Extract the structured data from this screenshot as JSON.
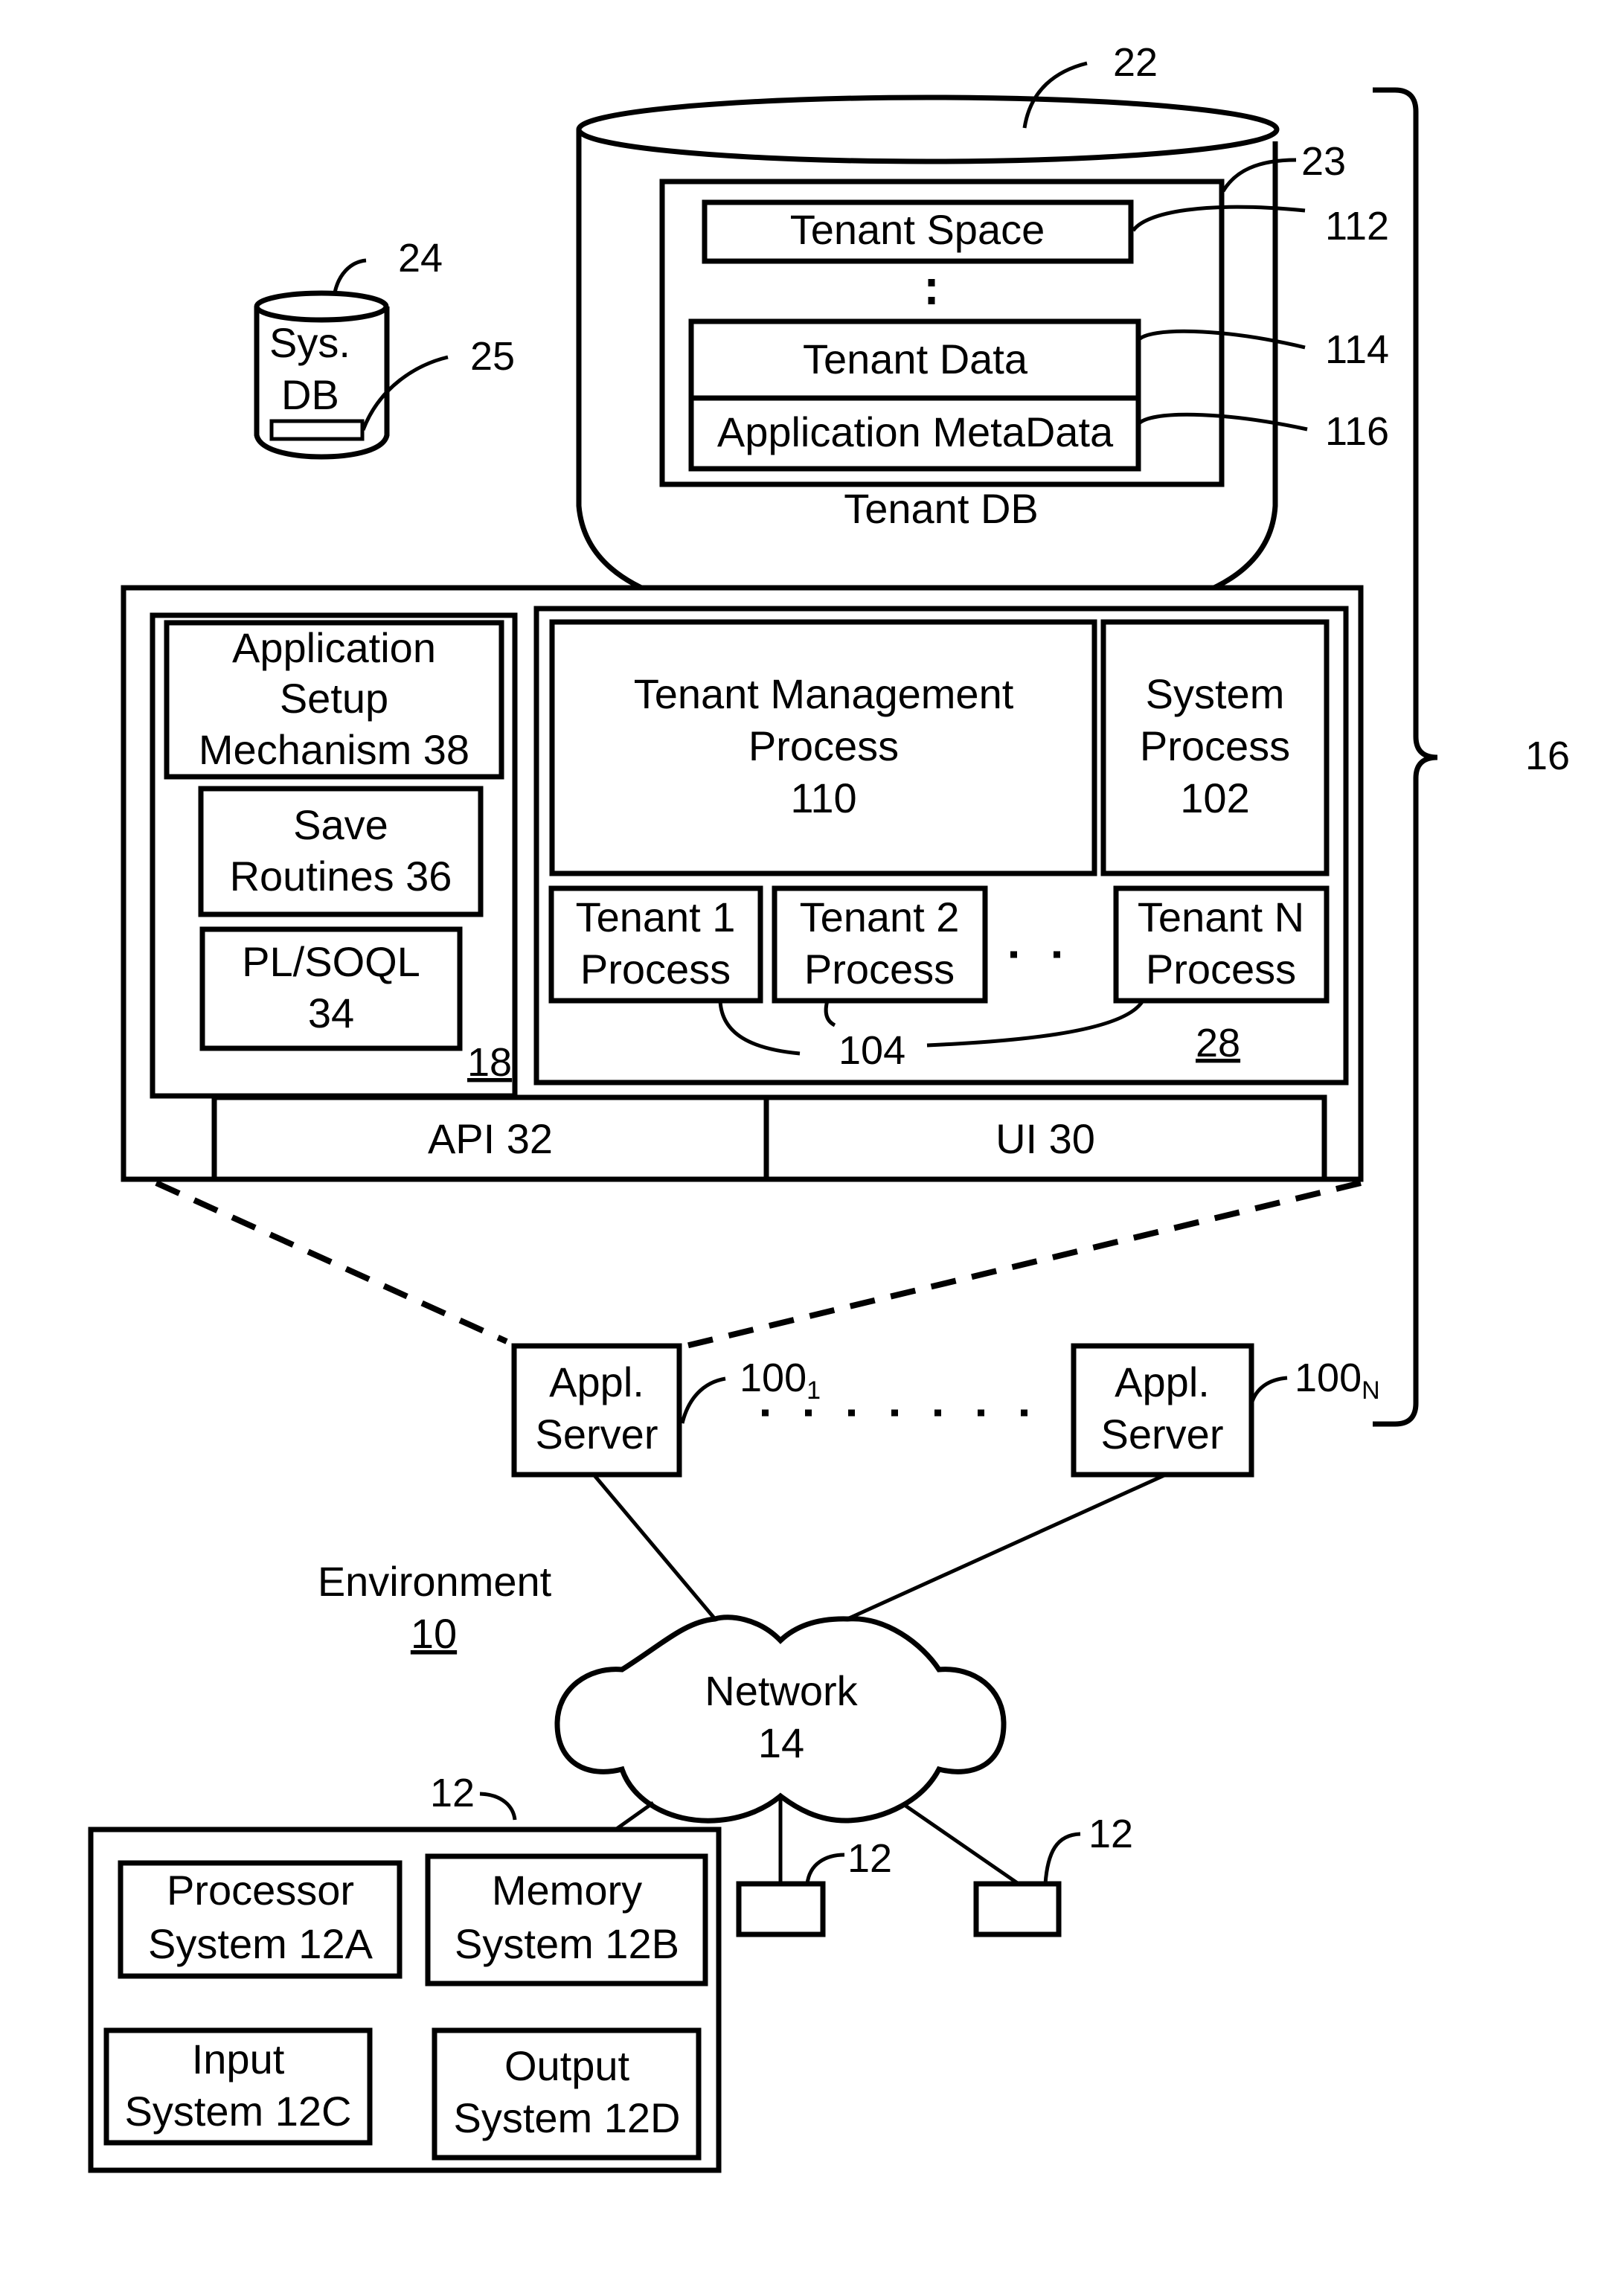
{
  "figure": {
    "environment": {
      "label": "Environment",
      "ref": "10"
    },
    "system_ref": "16",
    "tenant_db": {
      "ref": "22",
      "label": "Tenant DB",
      "storage_ref": "23",
      "tenant_space": {
        "label": "Tenant Space",
        "ref": "112"
      },
      "tenant_data": {
        "label": "Tenant Data",
        "ref": "114"
      },
      "app_metadata": {
        "label": "Application MetaData",
        "ref": "116"
      }
    },
    "system_db": {
      "ref": "24",
      "label_line1": "Sys.",
      "label_line2": "DB",
      "storage_ref": "25"
    },
    "app_platform": {
      "ref": "18",
      "setup": {
        "line1": "Application",
        "line2": "Setup",
        "line3": "Mechanism 38"
      },
      "save": {
        "line1": "Save",
        "line2": "Routines 36"
      },
      "plsoql": {
        "line1": "PL/SOQL",
        "line2": "34"
      }
    },
    "process_space": {
      "ref": "28",
      "tenant_mgmt": {
        "line1": "Tenant Management",
        "line2": "Process",
        "line3": "110"
      },
      "system_process": {
        "line1": "System",
        "line2": "Process",
        "line3": "102"
      },
      "tenants": [
        {
          "line1": "Tenant 1",
          "line2": "Process"
        },
        {
          "line1": "Tenant 2",
          "line2": "Process"
        },
        {
          "line1": "Tenant N",
          "line2": "Process"
        }
      ],
      "tenant_processes_ref": "104"
    },
    "api": "API 32",
    "ui": "UI 30",
    "app_servers": [
      {
        "line1": "Appl.",
        "line2": "Server",
        "ref_base": "100",
        "ref_sub": "1"
      },
      {
        "line1": "Appl.",
        "line2": "Server",
        "ref_base": "100",
        "ref_sub": "N"
      }
    ],
    "network": {
      "label": "Network",
      "ref": "14"
    },
    "user_system": {
      "ref": "12",
      "processor": {
        "line1": "Processor",
        "line2": "System 12A"
      },
      "memory": {
        "line1": "Memory",
        "line2": "System 12B"
      },
      "input": {
        "line1": "Input",
        "line2": "System 12C"
      },
      "output": {
        "line1": "Output",
        "line2": "System 12D"
      }
    },
    "other_user_systems": [
      {
        "ref": "12"
      },
      {
        "ref": "12"
      }
    ]
  }
}
